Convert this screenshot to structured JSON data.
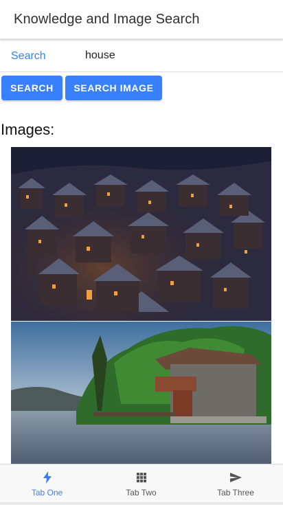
{
  "header": {
    "title": "Knowledge and Image Search"
  },
  "search": {
    "label": "Search",
    "value": "house"
  },
  "buttons": {
    "search": "Search",
    "search_image": "Search Image"
  },
  "images": {
    "heading": "Images:"
  },
  "tabs": [
    {
      "label": "Tab One",
      "icon": "flash-icon",
      "active": true
    },
    {
      "label": "Tab Two",
      "icon": "apps-grid-icon",
      "active": false
    },
    {
      "label": "Tab Three",
      "icon": "send-icon",
      "active": false
    }
  ],
  "colors": {
    "accent": "#3880ff",
    "text": "#303030",
    "tab_inactive": "#555555"
  }
}
